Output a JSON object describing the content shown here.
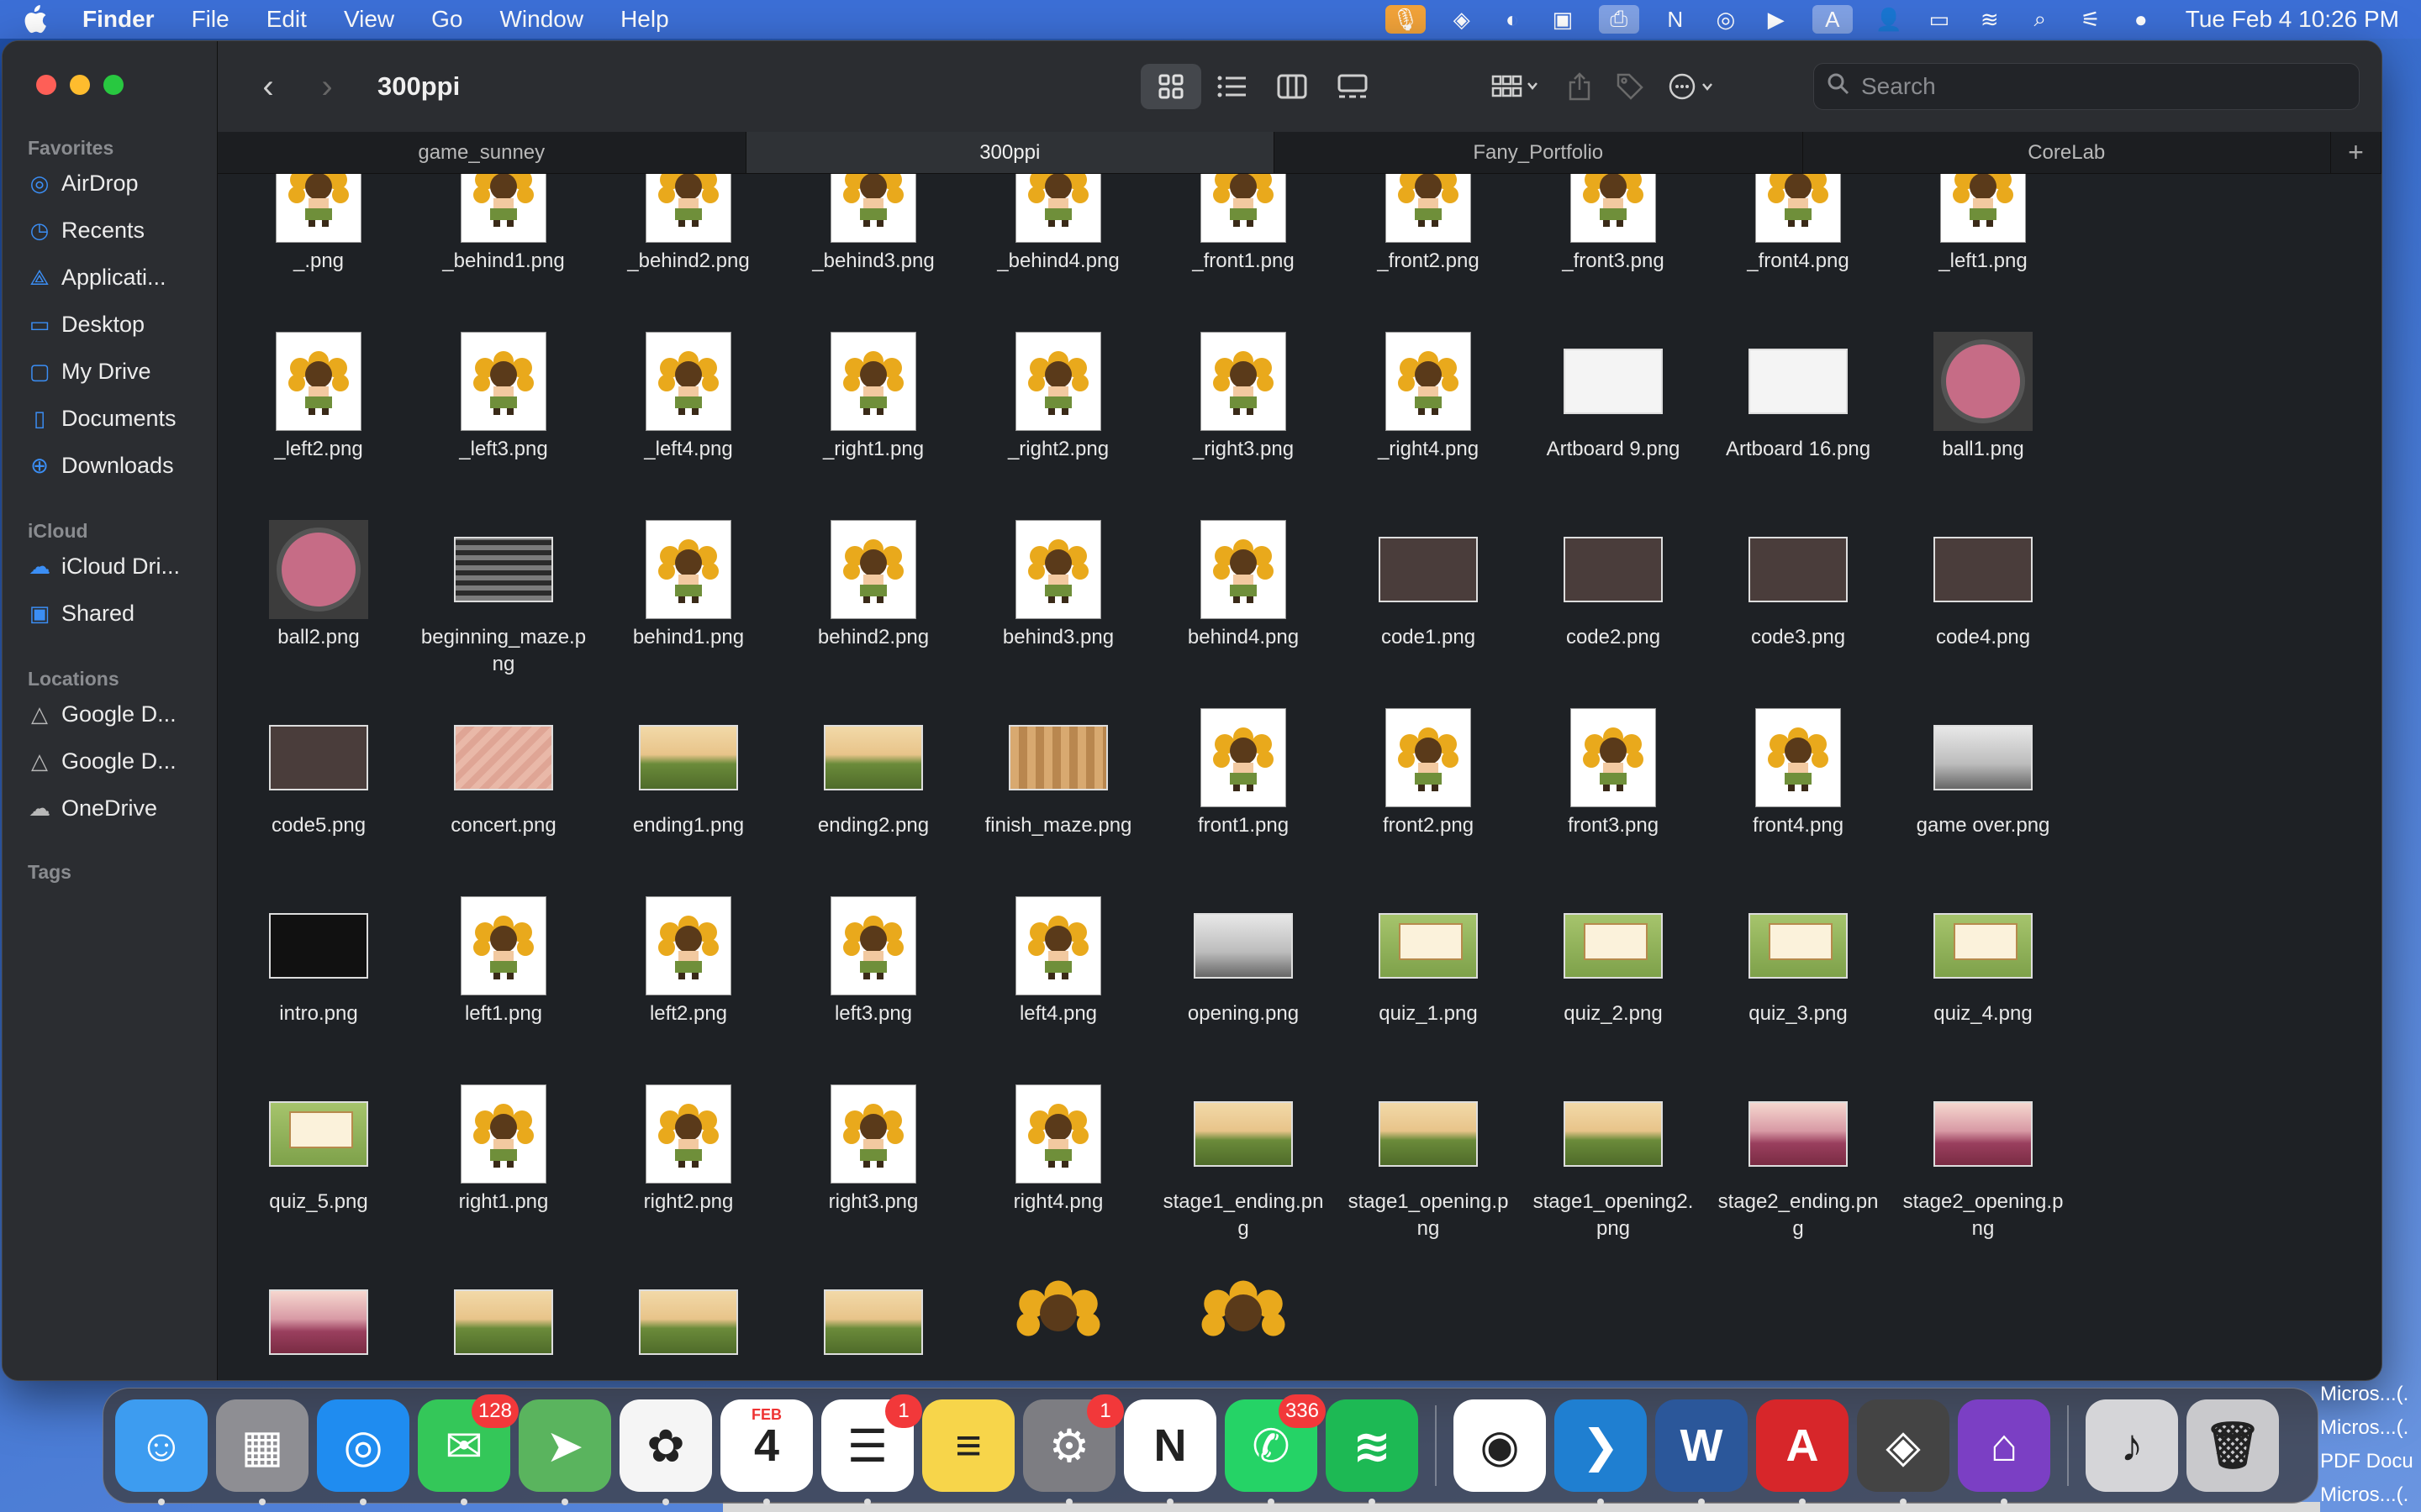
{
  "menubar": {
    "app_name": "Finder",
    "menus": [
      "File",
      "Edit",
      "View",
      "Go",
      "Window",
      "Help"
    ],
    "clock": "Tue Feb 4  10:26 PM"
  },
  "window": {
    "title": "300ppi",
    "search_placeholder": "Search"
  },
  "sidebar": {
    "favorites_label": "Favorites",
    "favorites": [
      {
        "label": "AirDrop",
        "icon": "airdrop-icon"
      },
      {
        "label": "Recents",
        "icon": "clock-icon"
      },
      {
        "label": "Applicati...",
        "icon": "applications-icon"
      },
      {
        "label": "Desktop",
        "icon": "desktop-icon"
      },
      {
        "label": "My Drive",
        "icon": "folder-icon"
      },
      {
        "label": "Documents",
        "icon": "document-icon"
      },
      {
        "label": "Downloads",
        "icon": "download-icon"
      }
    ],
    "icloud_label": "iCloud",
    "icloud": [
      {
        "label": "iCloud Dri...",
        "icon": "cloud-icon"
      },
      {
        "label": "Shared",
        "icon": "shared-folder-icon"
      }
    ],
    "locations_label": "Locations",
    "locations": [
      {
        "label": "Google D...",
        "icon": "drive-icon"
      },
      {
        "label": "Google D...",
        "icon": "drive-icon"
      },
      {
        "label": "OneDrive",
        "icon": "cloud-icon"
      }
    ],
    "tags_label": "Tags"
  },
  "tabs": [
    "game_sunney",
    "300ppi",
    "Fany_Portfolio",
    "CoreLab"
  ],
  "files": [
    {
      "name": "_.png",
      "kind": "sprite"
    },
    {
      "name": "_behind1.png",
      "kind": "sprite"
    },
    {
      "name": "_behind2.png",
      "kind": "sprite"
    },
    {
      "name": "_behind3.png",
      "kind": "sprite"
    },
    {
      "name": "_behind4.png",
      "kind": "sprite"
    },
    {
      "name": "_front1.png",
      "kind": "sprite"
    },
    {
      "name": "_front2.png",
      "kind": "sprite"
    },
    {
      "name": "_front3.png",
      "kind": "sprite"
    },
    {
      "name": "_front4.png",
      "kind": "sprite"
    },
    {
      "name": "_left1.png",
      "kind": "sprite"
    },
    {
      "name": "_left2.png",
      "kind": "sprite"
    },
    {
      "name": "_left3.png",
      "kind": "sprite"
    },
    {
      "name": "_left4.png",
      "kind": "sprite"
    },
    {
      "name": "_right1.png",
      "kind": "sprite"
    },
    {
      "name": "_right2.png",
      "kind": "sprite"
    },
    {
      "name": "_right3.png",
      "kind": "sprite"
    },
    {
      "name": "_right4.png",
      "kind": "sprite"
    },
    {
      "name": "Artboard 9.png",
      "kind": "light"
    },
    {
      "name": "Artboard 16.png",
      "kind": "light"
    },
    {
      "name": "ball1.png",
      "kind": "ball"
    },
    {
      "name": "ball2.png",
      "kind": "ball"
    },
    {
      "name": "beginning_maze.png",
      "kind": "mazeg"
    },
    {
      "name": "behind1.png",
      "kind": "sprite"
    },
    {
      "name": "behind2.png",
      "kind": "sprite"
    },
    {
      "name": "behind3.png",
      "kind": "sprite"
    },
    {
      "name": "behind4.png",
      "kind": "sprite"
    },
    {
      "name": "code1.png",
      "kind": "code"
    },
    {
      "name": "code2.png",
      "kind": "code"
    },
    {
      "name": "code3.png",
      "kind": "code"
    },
    {
      "name": "code4.png",
      "kind": "code"
    },
    {
      "name": "code5.png",
      "kind": "code"
    },
    {
      "name": "concert.png",
      "kind": "sand"
    },
    {
      "name": "ending1.png",
      "kind": "landscape"
    },
    {
      "name": "ending2.png",
      "kind": "landscape"
    },
    {
      "name": "finish_maze.png",
      "kind": "mazef"
    },
    {
      "name": "front1.png",
      "kind": "sprite"
    },
    {
      "name": "front2.png",
      "kind": "sprite"
    },
    {
      "name": "front3.png",
      "kind": "sprite"
    },
    {
      "name": "front4.png",
      "kind": "sprite"
    },
    {
      "name": "game over.png",
      "kind": "gray"
    },
    {
      "name": "intro.png",
      "kind": "dark"
    },
    {
      "name": "left1.png",
      "kind": "sprite"
    },
    {
      "name": "left2.png",
      "kind": "sprite"
    },
    {
      "name": "left3.png",
      "kind": "sprite"
    },
    {
      "name": "left4.png",
      "kind": "sprite"
    },
    {
      "name": "opening.png",
      "kind": "gray"
    },
    {
      "name": "quiz_1.png",
      "kind": "quiz"
    },
    {
      "name": "quiz_2.png",
      "kind": "quiz"
    },
    {
      "name": "quiz_3.png",
      "kind": "quiz"
    },
    {
      "name": "quiz_4.png",
      "kind": "quiz"
    },
    {
      "name": "quiz_5.png",
      "kind": "quiz"
    },
    {
      "name": "right1.png",
      "kind": "sprite"
    },
    {
      "name": "right2.png",
      "kind": "sprite"
    },
    {
      "name": "right3.png",
      "kind": "sprite"
    },
    {
      "name": "right4.png",
      "kind": "sprite"
    },
    {
      "name": "stage1_ending.png",
      "kind": "landscape"
    },
    {
      "name": "stage1_opening.png",
      "kind": "landscape"
    },
    {
      "name": "stage1_opening2.png",
      "kind": "landscape"
    },
    {
      "name": "stage2_ending.png",
      "kind": "pink"
    },
    {
      "name": "stage2_opening.png",
      "kind": "pink"
    },
    {
      "name": "",
      "kind": "pink"
    },
    {
      "name": "",
      "kind": "landscape"
    },
    {
      "name": "",
      "kind": "landscape"
    },
    {
      "name": "",
      "kind": "landscape"
    },
    {
      "name": "",
      "kind": "bigsun"
    },
    {
      "name": "",
      "kind": "bigsun"
    }
  ],
  "dock": [
    {
      "name": "finder-app",
      "color": "#3d9cf0",
      "glyph": "☺"
    },
    {
      "name": "launchpad-app",
      "color": "#8e8e93",
      "glyph": "▦"
    },
    {
      "name": "safari-app",
      "color": "#1f8cf0",
      "glyph": "◎"
    },
    {
      "name": "messages-app",
      "color": "#34c759",
      "glyph": "✉",
      "badge": "128"
    },
    {
      "name": "maps-app",
      "color": "#5ab45e",
      "glyph": "➤"
    },
    {
      "name": "photos-app",
      "color": "#f5f5f5",
      "glyph": "✿"
    },
    {
      "name": "calendar-app",
      "color": "#ffffff",
      "glyph": "4",
      "sub": "FEB"
    },
    {
      "name": "reminders-app",
      "color": "#ffffff",
      "glyph": "☰",
      "badge": "1"
    },
    {
      "name": "notes-app",
      "color": "#f7d54a",
      "glyph": "≡"
    },
    {
      "name": "system-settings-app",
      "color": "#7d7d82",
      "glyph": "⚙",
      "badge": "1"
    },
    {
      "name": "notion-app",
      "color": "#ffffff",
      "glyph": "N"
    },
    {
      "name": "whatsapp-app",
      "color": "#25d366",
      "glyph": "✆",
      "badge": "336"
    },
    {
      "name": "spotify-app",
      "color": "#1db954",
      "glyph": "≋"
    },
    {
      "name": "chrome-app",
      "color": "#ffffff",
      "glyph": "◉"
    },
    {
      "name": "vscode-app",
      "color": "#1f7fd1",
      "glyph": "❯"
    },
    {
      "name": "word-app",
      "color": "#2b579a",
      "glyph": "W"
    },
    {
      "name": "acrobat-app",
      "color": "#d7262a",
      "glyph": "A"
    },
    {
      "name": "unity-app",
      "color": "#444444",
      "glyph": "◈"
    },
    {
      "name": "github-desktop-app",
      "color": "#7b3fc4",
      "glyph": "⌂"
    },
    {
      "name": "music-folder",
      "color": "#d5d5d8",
      "glyph": "♪"
    },
    {
      "name": "trash",
      "color": "#c9c9cc",
      "glyph": "🗑"
    }
  ],
  "desktop_files": [
    "Micros...(.",
    "Micros...(.",
    "PDF Docu",
    "Micros...(."
  ],
  "colors": {
    "accent": "#3b8ef5",
    "window_bg": "#1e2125",
    "sidebar_bg": "#2b2d31",
    "menubar_bg": "#3c6fd6"
  }
}
